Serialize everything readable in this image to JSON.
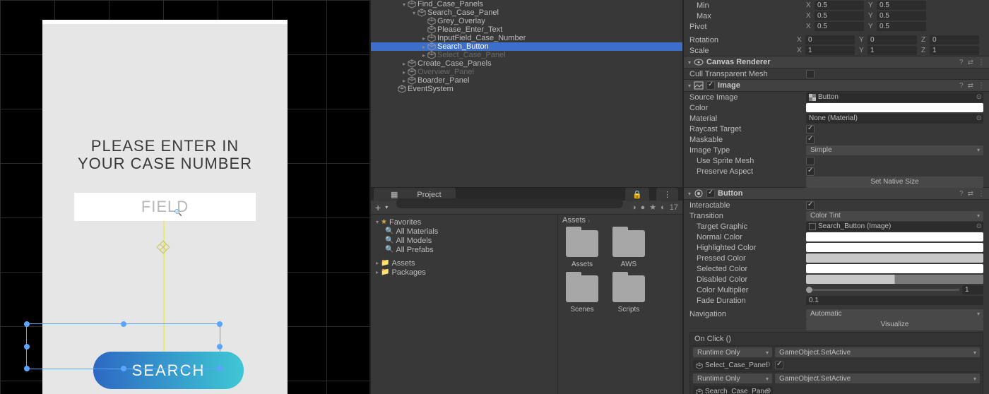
{
  "scene": {
    "prompt_line1": "PLEASE ENTER IN",
    "prompt_line2": "YOUR CASE NUMBER",
    "field_placeholder": "FIELD",
    "search_button": "SEARCH"
  },
  "hierarchy": [
    {
      "indent": 3,
      "label": "Find_Case_Panels",
      "fold": "down"
    },
    {
      "indent": 4,
      "label": "Search_Case_Panel",
      "fold": "down"
    },
    {
      "indent": 5,
      "label": "Grey_Overlay"
    },
    {
      "indent": 5,
      "label": "Please_Enter_Text"
    },
    {
      "indent": 5,
      "label": "InputField_Case_Number",
      "fold": "right"
    },
    {
      "indent": 5,
      "label": "Search_Button",
      "fold": "right",
      "selected": true
    },
    {
      "indent": 5,
      "label": "Select_Case_Panel",
      "fold": "right",
      "disabled": true
    },
    {
      "indent": 3,
      "label": "Create_Case_Panels",
      "fold": "right"
    },
    {
      "indent": 3,
      "label": "Overview_Panel",
      "fold": "right",
      "disabled": true
    },
    {
      "indent": 3,
      "label": "Boarder_Panel",
      "fold": "right"
    },
    {
      "indent": 2,
      "label": "EventSystem"
    }
  ],
  "project": {
    "tab": "Project",
    "count": "17",
    "favorites_label": "Favorites",
    "fav_items": [
      "All Materials",
      "All Models",
      "All Prefabs"
    ],
    "assets_label": "Assets",
    "packages_label": "Packages",
    "breadcrumb": "Assets",
    "folders": [
      "Assets",
      "AWS",
      "Scenes",
      "Scripts"
    ]
  },
  "inspector": {
    "transform": {
      "min_label": "Min",
      "max_label": "Max",
      "pivot_label": "Pivot",
      "rotation_label": "Rotation",
      "scale_label": "Scale",
      "min": {
        "x": "0.5",
        "y": "0.5"
      },
      "max": {
        "x": "0.5",
        "y": "0.5"
      },
      "pivot": {
        "x": "0.5",
        "y": "0.5"
      },
      "rotation": {
        "x": "0",
        "y": "0",
        "z": "0"
      },
      "scale": {
        "x": "1",
        "y": "1",
        "z": "1"
      }
    },
    "canvas_renderer": {
      "title": "Canvas Renderer",
      "cull_label": "Cull Transparent Mesh",
      "cull": false
    },
    "image": {
      "title": "Image",
      "source_label": "Source Image",
      "source": "Button",
      "color_label": "Color",
      "material_label": "Material",
      "material": "None (Material)",
      "raycast_label": "Raycast Target",
      "raycast": true,
      "maskable_label": "Maskable",
      "maskable": true,
      "type_label": "Image Type",
      "type": "Simple",
      "sprite_mesh_label": "Use Sprite Mesh",
      "sprite_mesh": false,
      "preserve_label": "Preserve Aspect",
      "preserve": true,
      "native_btn": "Set Native Size"
    },
    "button": {
      "title": "Button",
      "interactable_label": "Interactable",
      "interactable": true,
      "transition_label": "Transition",
      "transition": "Color Tint",
      "target_label": "Target Graphic",
      "target": "Search_Button (Image)",
      "normal_label": "Normal Color",
      "highlighted_label": "Highlighted Color",
      "pressed_label": "Pressed Color",
      "selected_label": "Selected Color",
      "disabled_label": "Disabled Color",
      "multiplier_label": "Color Multiplier",
      "multiplier": "1",
      "fade_label": "Fade Duration",
      "fade": "0.1",
      "navigation_label": "Navigation",
      "navigation": "Automatic",
      "visualize_btn": "Visualize",
      "onclick_label": "On Click ()",
      "events": [
        {
          "runtime": "Runtime Only",
          "method": "GameObject.SetActive",
          "object": "Select_Case_Panel",
          "arg": true
        },
        {
          "runtime": "Runtime Only",
          "method": "GameObject.SetActive",
          "object": "Search_Case_Panel"
        }
      ]
    }
  }
}
